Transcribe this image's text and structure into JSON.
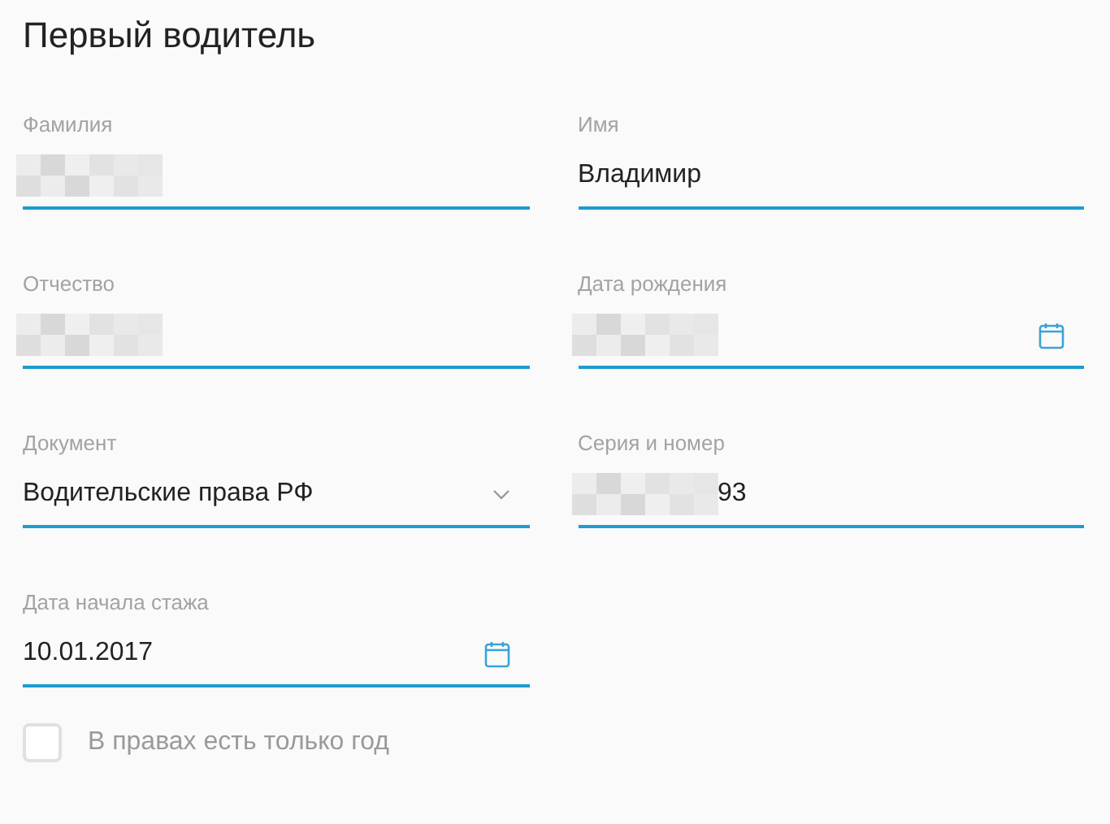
{
  "title": "Первый водитель",
  "fields": [
    {
      "label": "Фамилия",
      "kind": "text",
      "redacted": true
    },
    {
      "label": "Имя",
      "kind": "text",
      "value": "Владимир",
      "redacted": false
    },
    {
      "label": "Отчество",
      "kind": "text",
      "redacted": true
    },
    {
      "label": "Дата рождения",
      "kind": "date",
      "redacted": true
    },
    {
      "label": "Документ",
      "kind": "select",
      "value": "Водительские права РФ",
      "redacted": false
    },
    {
      "label": "Серия и номер",
      "kind": "text",
      "value": "93",
      "redacted": true
    },
    {
      "label": "Дата начала стажа",
      "kind": "date",
      "value": "10.01.2017",
      "redacted": false
    }
  ],
  "checkbox": {
    "label": "В правах есть только год",
    "checked": false
  }
}
